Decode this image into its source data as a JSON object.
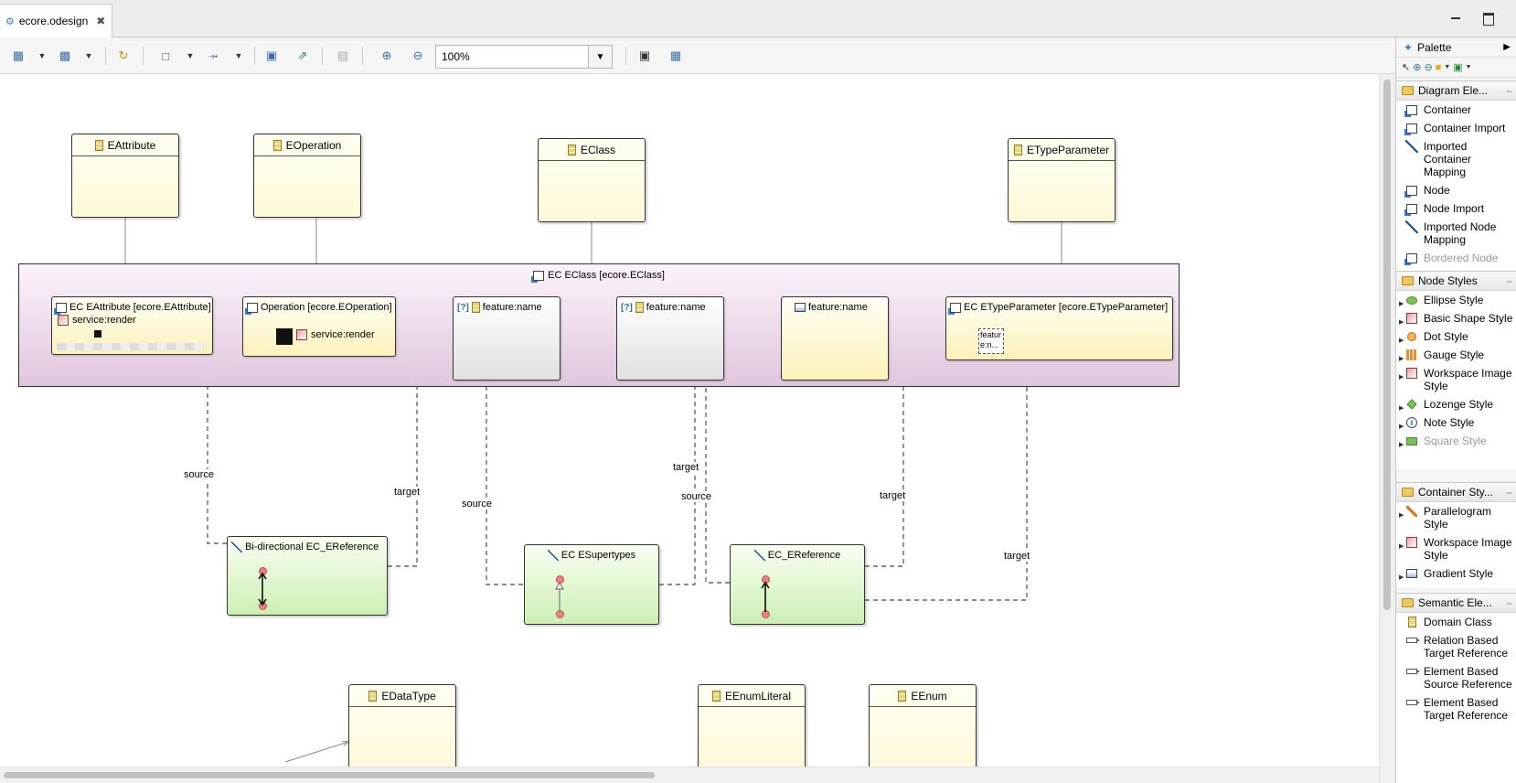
{
  "tab": {
    "title": "ecore.odesign"
  },
  "toolbar": {
    "zoom_value": "100%"
  },
  "diagram": {
    "classes": {
      "eattribute": "EAttribute",
      "eoperation": "EOperation",
      "eclass": "EClass",
      "etypeparameter": "ETypeParameter",
      "edatatype": "EDataType",
      "eenumliteral": "EEnumLiteral",
      "eenum": "EEnum"
    },
    "container_title": "EC EClass [ecore.EClass]",
    "subnodes": {
      "attribute_title": "EC EAttribute [ecore.EAttribute]",
      "attribute_service": "service:render",
      "operation_title": "Operation [ecore.EOperation]",
      "operation_service": "service:render",
      "feature1": "feature:name",
      "feature2": "feature:name",
      "feature3": "feature:name",
      "typeparam_title": "EC ETypeParameter [ecore.ETypeParameter]",
      "typeparam_inner": "featur e:n..."
    },
    "edge_nodes": {
      "bidir": "Bi-directional EC_EReference",
      "supertypes": "EC ESupertypes",
      "ereference": "EC_EReference"
    },
    "edge_labels": {
      "bidir_source": "source",
      "bidir_target": "target",
      "super_source": "source",
      "super_target": "target",
      "ref_source": "source",
      "ref_target1": "target",
      "ref_target2": "target"
    }
  },
  "palette": {
    "title": "Palette",
    "drawers": [
      {
        "title": "Diagram Ele...",
        "items": [
          "Container",
          "Container Import",
          "Imported Container Mapping",
          "Node",
          "Node Import",
          "Imported Node Mapping",
          "Bordered Node"
        ]
      },
      {
        "title": "Node Styles",
        "items": [
          "Ellipse Style",
          "Basic Shape Style",
          "Dot Style",
          "Gauge Style",
          "Workspace Image Style",
          "Lozenge Style",
          "Note Style",
          "Square Style"
        ]
      },
      {
        "title": "Container Sty...",
        "items": [
          "Parallelogram Style",
          "Workspace Image Style",
          "Gradient Style"
        ]
      },
      {
        "title": "Semantic Ele...",
        "items": [
          "Domain Class",
          "Relation Based Target Reference",
          "Element Based Source Reference",
          "Element Based Target Reference"
        ]
      }
    ]
  }
}
